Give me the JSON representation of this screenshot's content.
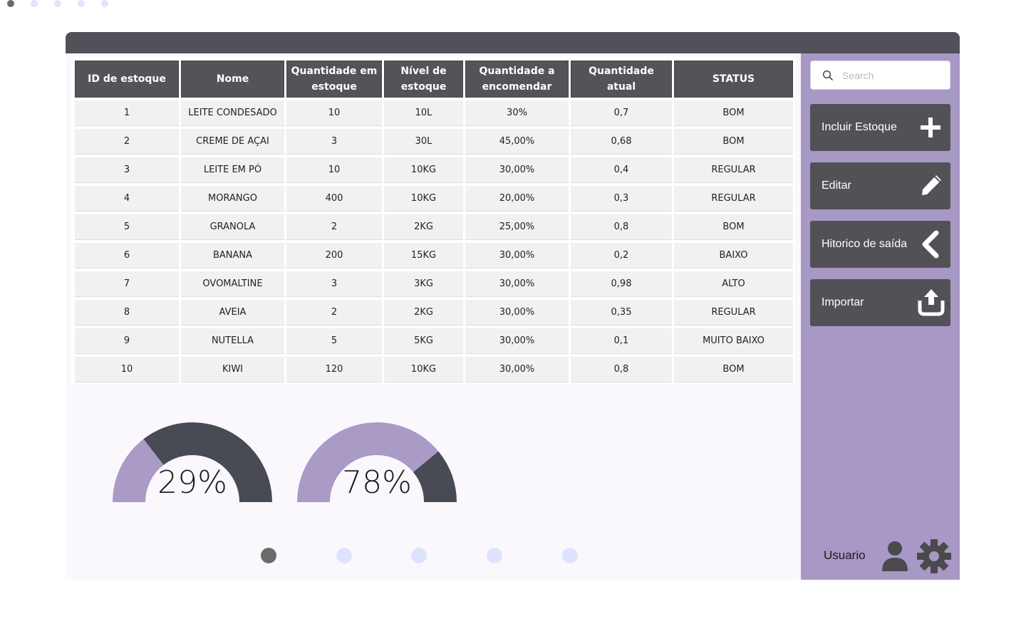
{
  "page_dots_top": {
    "count": 5,
    "active_index": 0
  },
  "table": {
    "headers": [
      "ID de estoque",
      "Nome",
      "Quantidade em estoque",
      "Nível de estoque",
      "Quantidade a encomendar",
      "Quantidade atual",
      "STATUS"
    ],
    "rows": [
      [
        "1",
        "LEITE CONDESADO",
        "10",
        "10L",
        "30%",
        "0,7",
        "BOM"
      ],
      [
        "2",
        "CREME DE AÇAI",
        "3",
        "30L",
        "45,00%",
        "0,68",
        "BOM"
      ],
      [
        "3",
        "LEITE EM PÓ",
        "10",
        "10KG",
        "30,00%",
        "0,4",
        "REGULAR"
      ],
      [
        "4",
        "MORANGO",
        "400",
        "10KG",
        "20,00%",
        "0,3",
        "REGULAR"
      ],
      [
        "5",
        "GRANOLA",
        "2",
        "2KG",
        "25,00%",
        "0,8",
        "BOM"
      ],
      [
        "6",
        "BANANA",
        "200",
        "15KG",
        "30,00%",
        "0,2",
        "BAIXO"
      ],
      [
        "7",
        "OVOMALTINE",
        "3",
        "3KG",
        "30,00%",
        "0,98",
        "ALTO"
      ],
      [
        "8",
        "AVEIA",
        "2",
        "2KG",
        "30,00%",
        "0,35",
        "REGULAR"
      ],
      [
        "9",
        "NUTELLA",
        "5",
        "5KG",
        "30,00%",
        "0,1",
        "MUITO BAIXO"
      ],
      [
        "10",
        "KIWI",
        "120",
        "10KG",
        "30,00%",
        "0,8",
        "BOM"
      ]
    ]
  },
  "gauges": [
    {
      "label": "29%",
      "value": 0.29
    },
    {
      "label": "78%",
      "value": 0.78
    }
  ],
  "colors": {
    "accent": "#a898c5",
    "dark": "#525256",
    "gauge_fill": "#a99ac6",
    "gauge_track": "#484b54",
    "dot_active": "#6b6b6b",
    "dot_inactive": "#dfe2fc"
  },
  "bottom_dots": {
    "count": 5,
    "active_index": 0
  },
  "sidebar": {
    "search_placeholder": "Search",
    "buttons": [
      {
        "label": "Incluir Estoque",
        "icon": "plus-icon"
      },
      {
        "label": "Editar",
        "icon": "pencil-icon"
      },
      {
        "label": "Hitorico de saída",
        "icon": "chevron-left-icon"
      },
      {
        "label": "Importar",
        "icon": "upload-icon"
      }
    ],
    "user_label": "Usuario"
  }
}
